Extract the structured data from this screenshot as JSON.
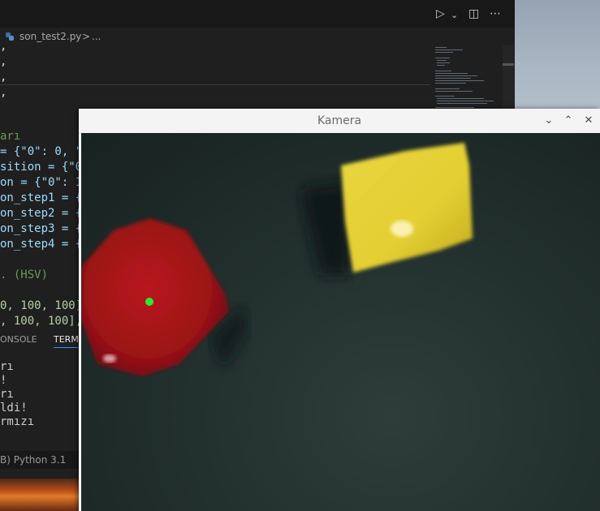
{
  "editor": {
    "breadcrumb": {
      "file": "son_test2.py",
      "separator": ">",
      "more": "..."
    },
    "code_lines": [
      ",",
      ",",
      ",",
      ",",
      "",
      "arı",
      "= {\"0\": 0, \"",
      "sition = {\"0\"",
      "on = {\"0\": 12",
      "on_step1 = {\"",
      "on_step2 = {\"",
      "on_step3 = {\"",
      "on_step4 = {\"",
      "",
      ". (HSV)",
      "",
      "0, 100, 100]",
      ", 100, 100],"
    ],
    "panel_tabs": {
      "console": "ONSOLE",
      "terminal": "TERMI"
    },
    "terminal_lines": [
      "rı",
      "!",
      "rı",
      "ldi!",
      "rmızı"
    ],
    "statusbar": "B) Python 3.1"
  },
  "kamera": {
    "title": "Kamera",
    "buttons": {
      "minimize": "⌄",
      "maximize": "⌃",
      "close": "✕"
    },
    "objects": [
      {
        "label": "red-block",
        "color": "#a31418"
      },
      {
        "label": "yellow-block",
        "color": "#e6d23a"
      }
    ],
    "marker_color": "#2eea2e"
  }
}
